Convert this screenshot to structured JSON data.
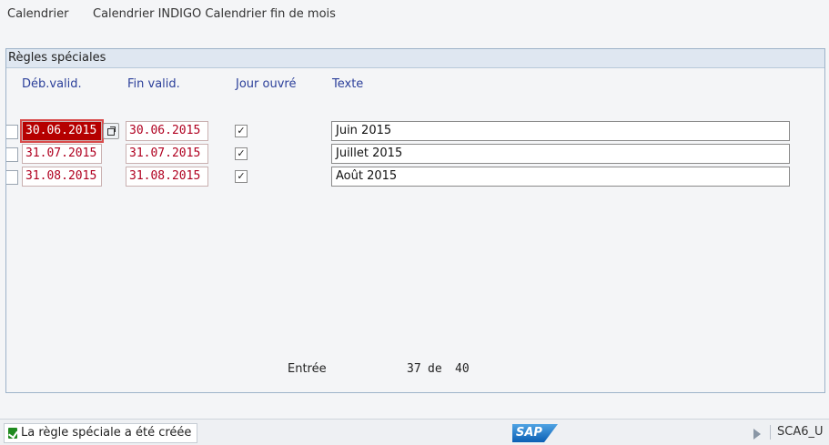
{
  "header": {
    "calendar_label": "Calendrier",
    "calendar_value": "Calendrier INDIGO Calendrier fin de mois"
  },
  "panel": {
    "title": "Règles spéciales",
    "columns": [
      "Déb.valid.",
      "Fin valid.",
      "Jour ouvré",
      "Texte"
    ],
    "rows": [
      {
        "start": "30.06.2015",
        "end": "30.06.2015",
        "workday": "✓",
        "text": "Juin 2015"
      },
      {
        "start": "31.07.2015",
        "end": "31.07.2015",
        "workday": "✓",
        "text": "Juillet 2015"
      },
      {
        "start": "31.08.2015",
        "end": "31.08.2015",
        "workday": "✓",
        "text": "Août 2015"
      }
    ],
    "entry_label": "Entrée",
    "entry_current": "37",
    "entry_of": "de",
    "entry_total": "40"
  },
  "status": {
    "message": "La règle spéciale a été créée",
    "logo": "SAP",
    "system": "SCA6_U"
  },
  "icons": {
    "status": "success-icon",
    "value_help": "value-help-icon",
    "nav": "play-icon"
  },
  "colors": {
    "focus": "#b50000",
    "header_text": "#2b3f9a",
    "date_text": "#b00020"
  }
}
